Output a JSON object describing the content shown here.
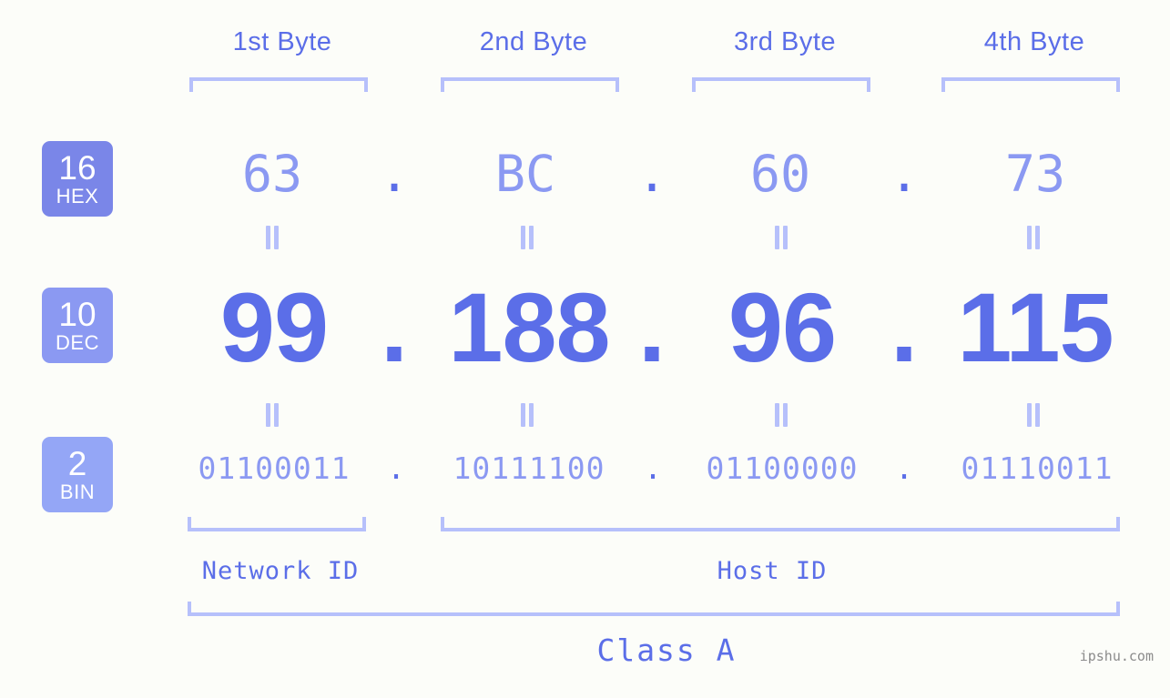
{
  "meta": {
    "watermark": "ipshu.com",
    "background_color": "#fcfdf9",
    "accent_strong": "#5b6ee8",
    "accent_light": "#8b99f2",
    "accent_pale": "#b6c0fb"
  },
  "headers": [
    {
      "label": "1st Byte"
    },
    {
      "label": "2nd Byte"
    },
    {
      "label": "3rd Byte"
    },
    {
      "label": "4th Byte"
    }
  ],
  "bases": [
    {
      "number": "16",
      "name": "HEX",
      "color": "#7a86e8"
    },
    {
      "number": "10",
      "name": "DEC",
      "color": "#8b99f2"
    },
    {
      "number": "2",
      "name": "BIN",
      "color": "#94a6f6"
    }
  ],
  "rows": {
    "hex": {
      "base_label": "HEX",
      "values": [
        "63",
        "BC",
        "60",
        "73"
      ],
      "separator": "."
    },
    "dec": {
      "base_label": "DEC",
      "values": [
        "99",
        "188",
        "96",
        "115"
      ],
      "separator": "."
    },
    "bin": {
      "base_label": "BIN",
      "values": [
        "01100011",
        "10111100",
        "01100000",
        "01110011"
      ],
      "separator": "."
    }
  },
  "equals_marks": {
    "symbol": "=",
    "count_per_row": 4
  },
  "id_sections": [
    {
      "label": "Network ID"
    },
    {
      "label": "Host ID"
    }
  ],
  "class_section": {
    "label": "Class A"
  }
}
